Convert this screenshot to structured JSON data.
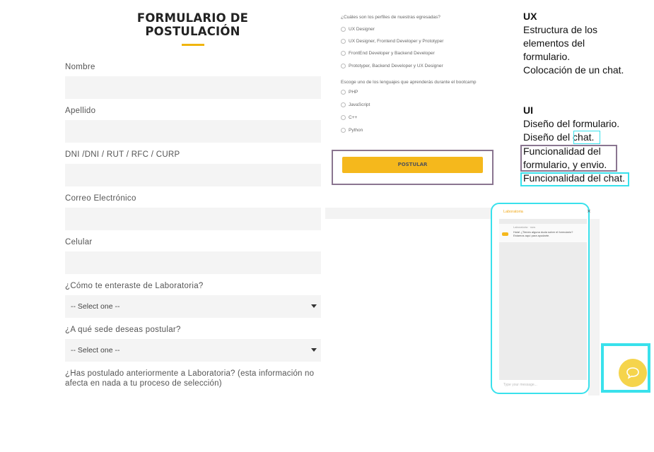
{
  "form": {
    "title": "FORMULARIO DE POSTULACIÓN",
    "fields": [
      {
        "label": "Nombre",
        "value": ""
      },
      {
        "label": "Apellido",
        "value": ""
      },
      {
        "label": "DNI /DNI / RUT / RFC / CURP",
        "value": ""
      },
      {
        "label": "Correo Electrónico",
        "value": ""
      },
      {
        "label": "Celular",
        "value": ""
      }
    ],
    "selects": [
      {
        "label": "¿Cómo te enteraste de Laboratoria?",
        "value": "-- Select one --"
      },
      {
        "label": "¿A qué sede deseas postular?",
        "value": "-- Select one --"
      }
    ],
    "last_question": "¿Has postulado anteriormente a Laboratoria? (esta información no afecta en nada a tu proceso de selección)"
  },
  "profiles": {
    "question": "¿Cuáles son los perfiles de nuestras egresadas?",
    "options": [
      "UX Designer",
      "UX Designer, Frontend Developer y Prototyper",
      "FrontEnd Developer y Backend Developer",
      "Prototyper, Backend Developer y UX Designer"
    ]
  },
  "languages": {
    "question": "Escoge uno de los lenguajes que aprenderás durante el bootcamp",
    "options": [
      "PHP",
      "JavaScript",
      "C++",
      "Python"
    ]
  },
  "submit_label": "POSTULAR",
  "chat": {
    "header": "Laboratoria",
    "close": "×",
    "msg_meta": "Laboratoria · now",
    "message": "Hola! ¿Tienes alguna duda sobre el formulario? Estamos aquí para ayudarte.",
    "input_placeholder": "Type your message...",
    "launcher_icon": "chat-bubble-icon"
  },
  "notes": {
    "ux_head": "UX",
    "ux_lines": [
      "Estructura de los",
      "elementos del",
      "formulario.",
      "Colocación de un chat."
    ],
    "ui_head": "UI",
    "ui_line1": "Diseño del formulario.",
    "ui_line2_prefix": "Diseño del ",
    "ui_line2_chat": "chat.",
    "ui_func_1": "Funcionalidad del",
    "ui_func_2": "formulario, y envio.",
    "ui_func_chat": "Funcionalidad del chat."
  },
  "colors": {
    "accent_yellow": "#f5b81c",
    "annotation_cyan": "#39e1ec",
    "annotation_purple": "#8a7590"
  }
}
